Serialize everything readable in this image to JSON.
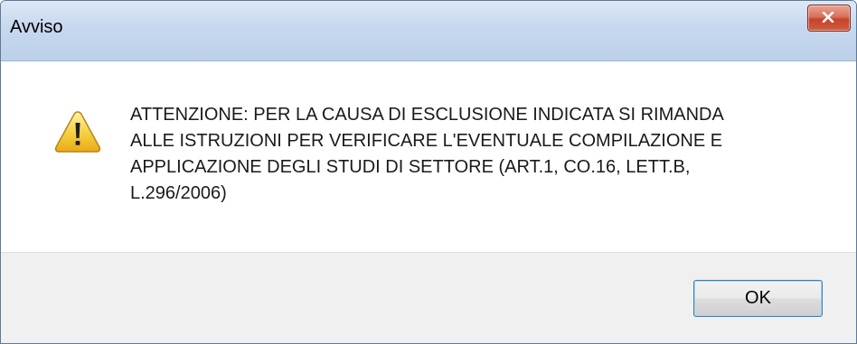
{
  "dialog": {
    "title": "Avviso",
    "close_icon": "close-icon",
    "warning_icon": "warning-icon",
    "message_lines": [
      "ATTENZIONE: PER LA CAUSA DI ESCLUSIONE INDICATA SI RIMANDA",
      "ALLE ISTRUZIONI PER VERIFICARE L'EVENTUALE COMPILAZIONE E",
      "APPLICAZIONE DEGLI STUDI DI SETTORE (ART.1, CO.16, LETT.B,",
      "L.296/2006)"
    ],
    "ok_label": "OK",
    "colors": {
      "titlebar": "#c7d8ee",
      "close_button": "#c4432b",
      "footer": "#f0f0f0",
      "ok_border": "#3c7fb1"
    }
  }
}
